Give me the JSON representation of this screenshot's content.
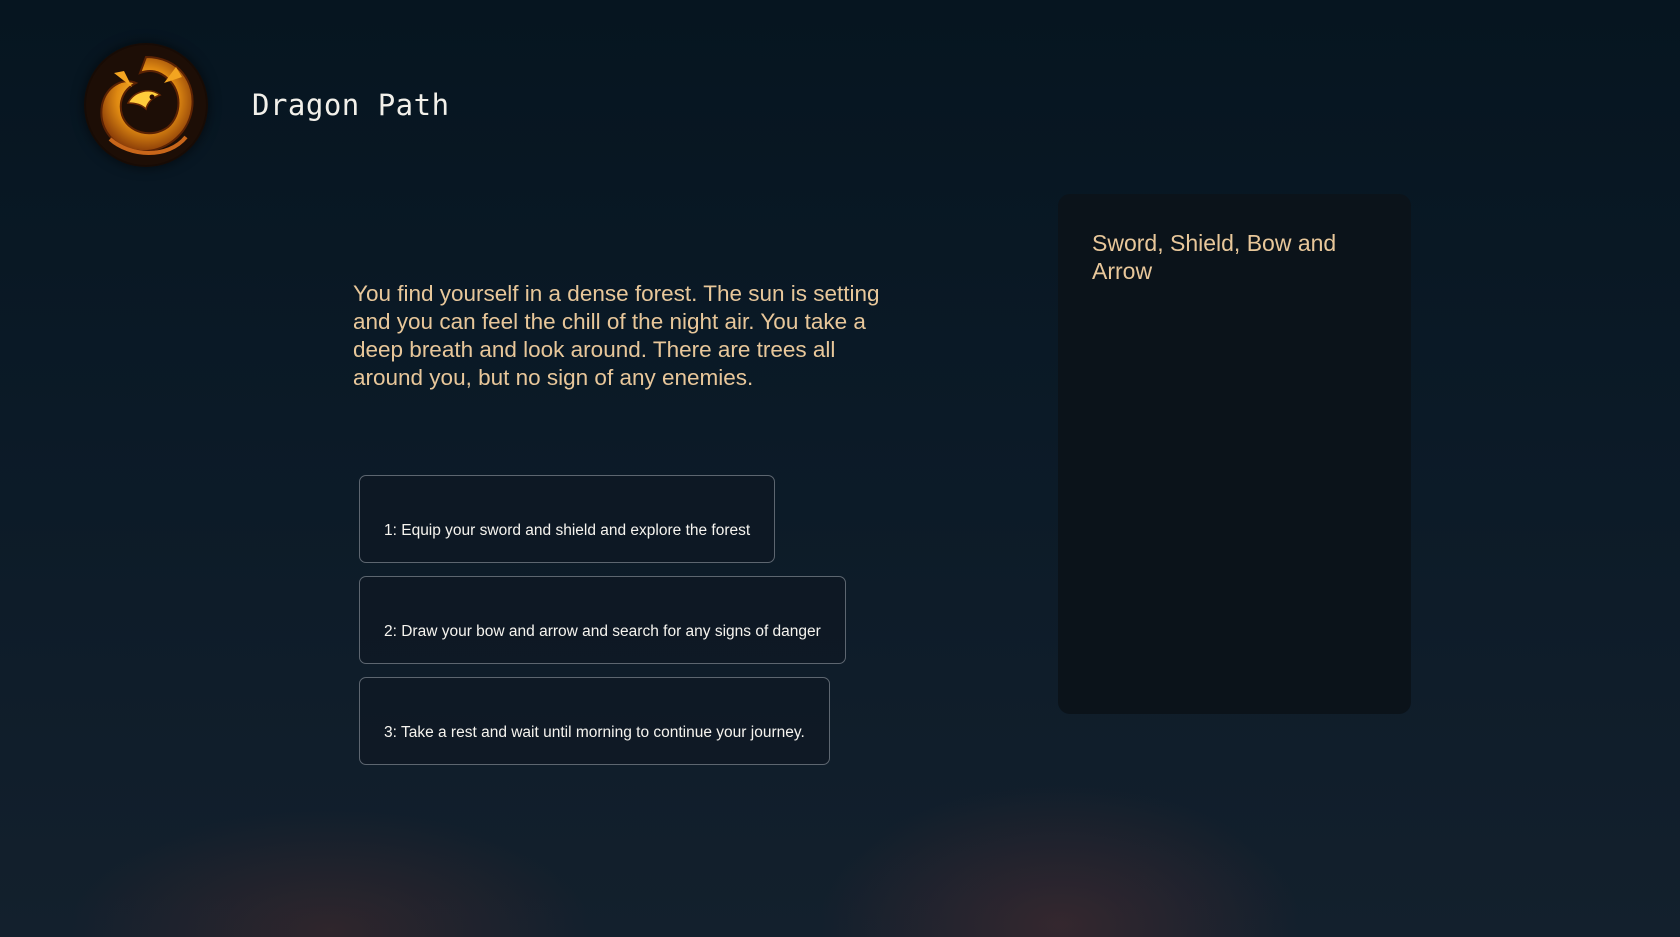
{
  "header": {
    "logo_icon": "dragon-emblem-icon",
    "title": "Dragon Path"
  },
  "story": {
    "text": "You find yourself in a dense forest. The sun is setting and you can feel the chill of the night air. You take a deep breath and look around. There are trees all around you, but no sign of any enemies."
  },
  "choices": [
    {
      "label": "1: Equip your sword and shield and explore the forest"
    },
    {
      "label": "2: Draw your bow and arrow and search for any signs of danger"
    },
    {
      "label": "3: Take a rest and wait until morning to continue your journey."
    }
  ],
  "inventory": {
    "items_text": "Sword, Shield, Bow and Arrow"
  },
  "colors": {
    "accent_text": "#e8c79a",
    "background": "#0b1a27",
    "panel": "#0b131a"
  }
}
